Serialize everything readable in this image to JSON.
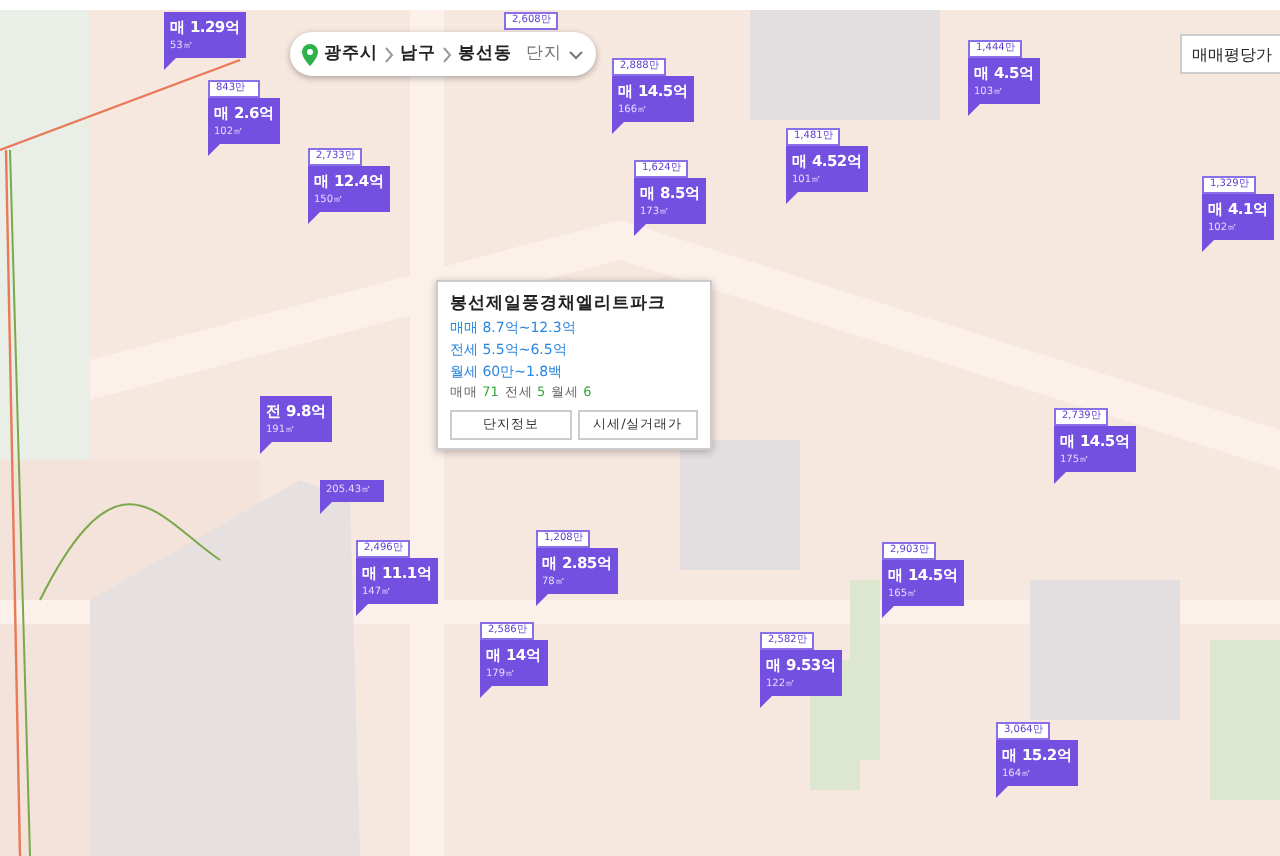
{
  "search_bar": {
    "crumbs": [
      "광주시",
      "남구",
      "봉선동"
    ],
    "dropdown": "단지"
  },
  "price_filter": {
    "label": "매매평당가"
  },
  "markers": [
    {
      "price": "매 1.29억",
      "area": "53㎡"
    },
    {
      "tag": "843만",
      "price": "매 2.6억",
      "area": "102㎡"
    },
    {
      "tag": "2,733만",
      "price": "매 12.4억",
      "area": "150㎡"
    },
    {
      "tag": "2,608만"
    },
    {
      "tag": "2,888만",
      "price": "매 14.5억",
      "area": "166㎡"
    },
    {
      "tag": "1,624만",
      "price": "매 8.5억",
      "area": "173㎡"
    },
    {
      "tag": "1,481만",
      "price": "매 4.52억",
      "area": "101㎡"
    },
    {
      "tag": "1,444만",
      "price": "매 4.5억",
      "area": "103㎡"
    },
    {
      "tag": "1,329만",
      "price": "매 4.1억",
      "area": "102㎡"
    },
    {
      "price": "전 9.8억",
      "area": "191㎡"
    },
    {
      "area": "205.43㎡"
    },
    {
      "tag": "2,496만",
      "price": "매 11.1억",
      "area": "147㎡"
    },
    {
      "tag": "1,208만",
      "price": "매 2.85억",
      "area": "78㎡"
    },
    {
      "tag": "2,586만",
      "price": "매 14억",
      "area": "179㎡"
    },
    {
      "tag": "2,903만",
      "price": "매 14.5억",
      "area": "165㎡"
    },
    {
      "tag": "2,582만",
      "price": "매 9.53억",
      "area": "122㎡"
    },
    {
      "tag": "2,739만",
      "price": "매 14.5억",
      "area": "175㎡"
    },
    {
      "tag": "3,064만",
      "price": "매 15.2억",
      "area": "164㎡"
    }
  ],
  "popup": {
    "title": "봉선제일풍경채엘리트파크",
    "ranges": [
      "매매 8.7억~12.3억",
      "전세 5.5억~6.5억",
      "월세 60만~1.8백"
    ],
    "counts": [
      {
        "label": "매매",
        "value": "71"
      },
      {
        "label": "전세",
        "value": "5"
      },
      {
        "label": "월세",
        "value": "6"
      }
    ],
    "buttons": [
      "단지정보",
      "시세/실거래가"
    ]
  }
}
